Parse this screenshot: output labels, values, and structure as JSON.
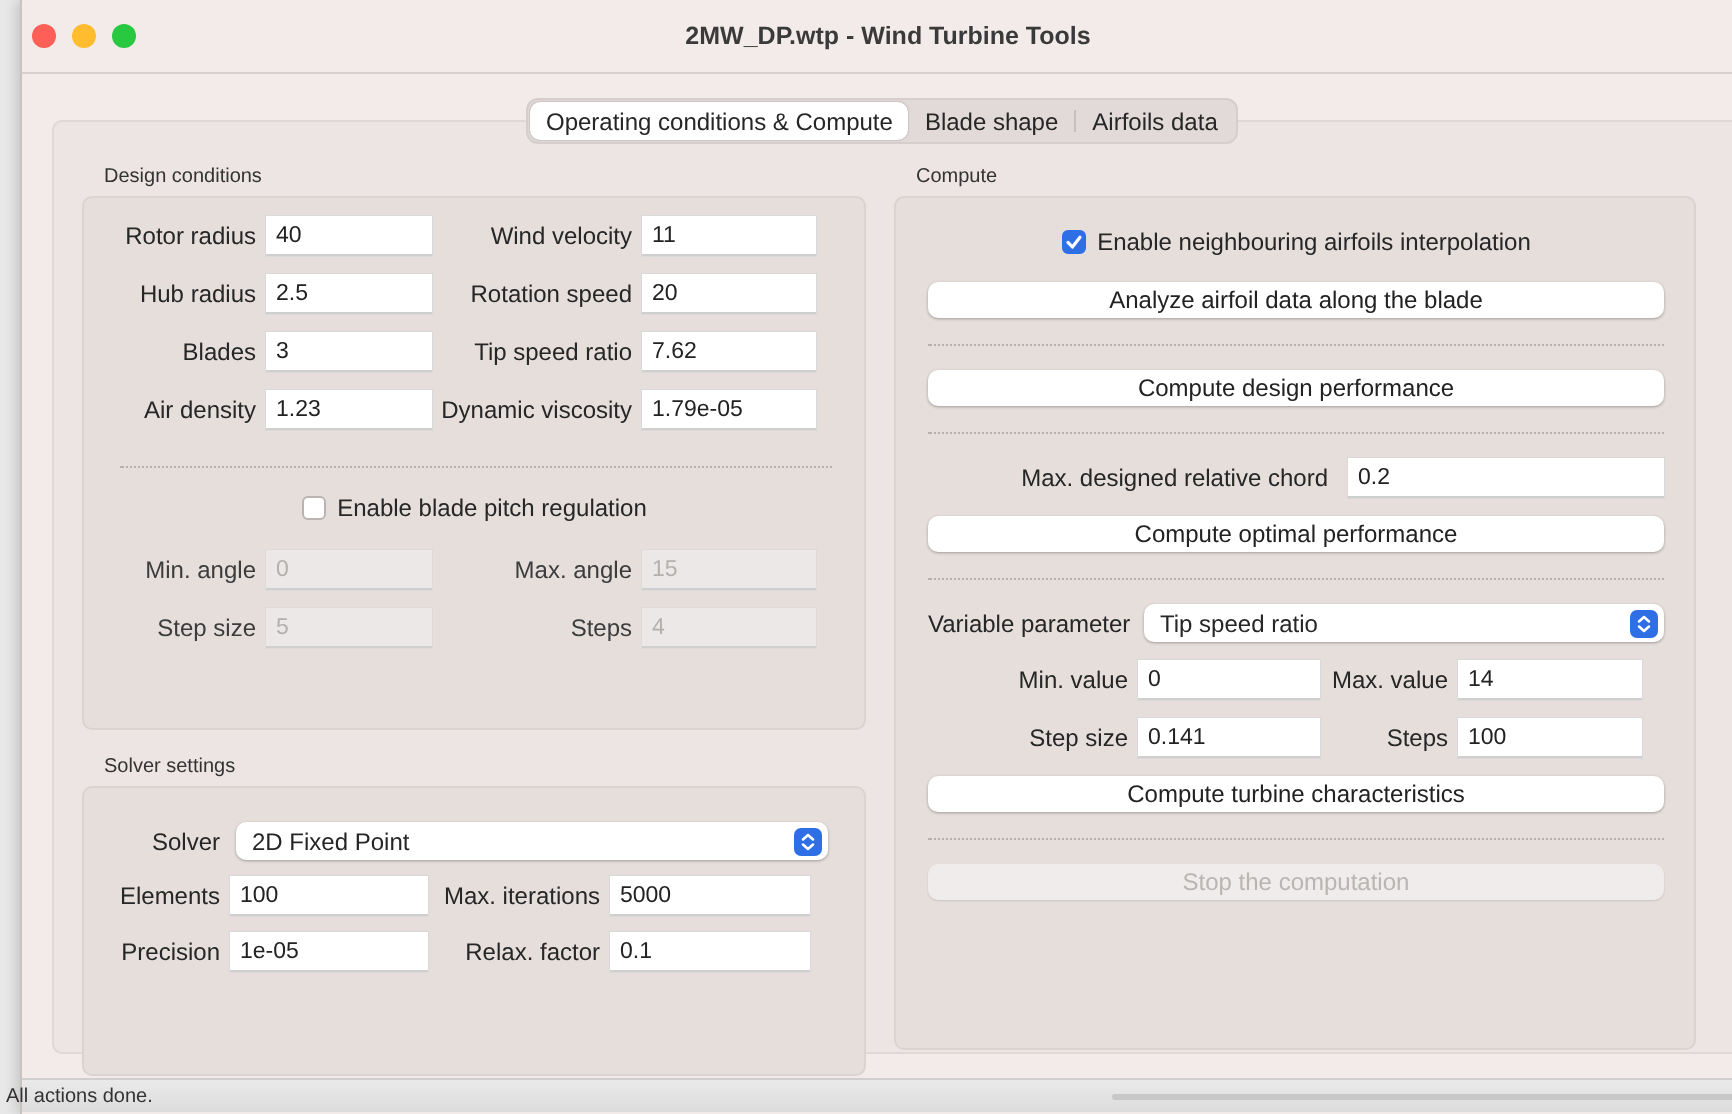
{
  "window": {
    "title": "2MW_DP.wtp - Wind Turbine Tools"
  },
  "tabs": [
    {
      "label": "Operating conditions & Compute",
      "selected": true
    },
    {
      "label": "Blade shape",
      "selected": false
    },
    {
      "label": "Airfoils data",
      "selected": false
    }
  ],
  "design_conditions": {
    "title": "Design conditions",
    "fields": [
      {
        "label": "Rotor radius",
        "value": "40",
        "disabled": false
      },
      {
        "label": "Wind velocity",
        "value": "11",
        "disabled": false
      },
      {
        "label": "Hub radius",
        "value": "2.5",
        "disabled": false
      },
      {
        "label": "Rotation speed",
        "value": "20",
        "disabled": false
      },
      {
        "label": "Blades",
        "value": "3",
        "disabled": false
      },
      {
        "label": "Tip speed ratio",
        "value": "7.62",
        "disabled": false
      },
      {
        "label": "Air density",
        "value": "1.23",
        "disabled": false
      },
      {
        "label": "Dynamic viscosity",
        "value": "1.79e-05",
        "disabled": false
      }
    ],
    "pitch_checkbox": {
      "label": "Enable blade pitch regulation",
      "checked": false
    },
    "pitch_fields": [
      {
        "label": "Min. angle",
        "value": "0",
        "disabled": true
      },
      {
        "label": "Max. angle",
        "value": "15",
        "disabled": true
      },
      {
        "label": "Step size",
        "value": "5",
        "disabled": true
      },
      {
        "label": "Steps",
        "value": "4",
        "disabled": true
      }
    ]
  },
  "solver_settings": {
    "title": "Solver settings",
    "solver": {
      "label": "Solver",
      "value": "2D Fixed Point"
    },
    "fields": [
      {
        "label": "Elements",
        "value": "100",
        "disabled": false
      },
      {
        "label": "Max. iterations",
        "value": "5000",
        "disabled": false
      },
      {
        "label": "Precision",
        "value": "1e-05",
        "disabled": false
      },
      {
        "label": "Relax. factor",
        "value": "0.1",
        "disabled": false
      }
    ]
  },
  "compute": {
    "title": "Compute",
    "interpolation_checkbox": {
      "label": "Enable neighbouring airfoils interpolation",
      "checked": true
    },
    "analyze_button": {
      "label": "Analyze airfoil data along the blade",
      "disabled": false
    },
    "design_button": {
      "label": "Compute design performance",
      "disabled": false
    },
    "chord_field": {
      "label": "Max. designed relative chord",
      "value": "0.2"
    },
    "optimal_button": {
      "label": "Compute optimal performance",
      "disabled": false
    },
    "variable_select": {
      "label": "Variable parameter",
      "value": "Tip speed ratio"
    },
    "range_fields": [
      {
        "label": "Min. value",
        "value": "0",
        "disabled": false
      },
      {
        "label": "Max. value",
        "value": "14",
        "disabled": false
      },
      {
        "label": "Step size",
        "value": "0.141",
        "disabled": false
      },
      {
        "label": "Steps",
        "value": "100",
        "disabled": false
      }
    ],
    "characteristics_button": {
      "label": "Compute turbine characteristics",
      "disabled": false
    },
    "stop_button": {
      "label": "Stop the computation",
      "disabled": true
    }
  },
  "status_bar": {
    "text": "All actions done."
  }
}
